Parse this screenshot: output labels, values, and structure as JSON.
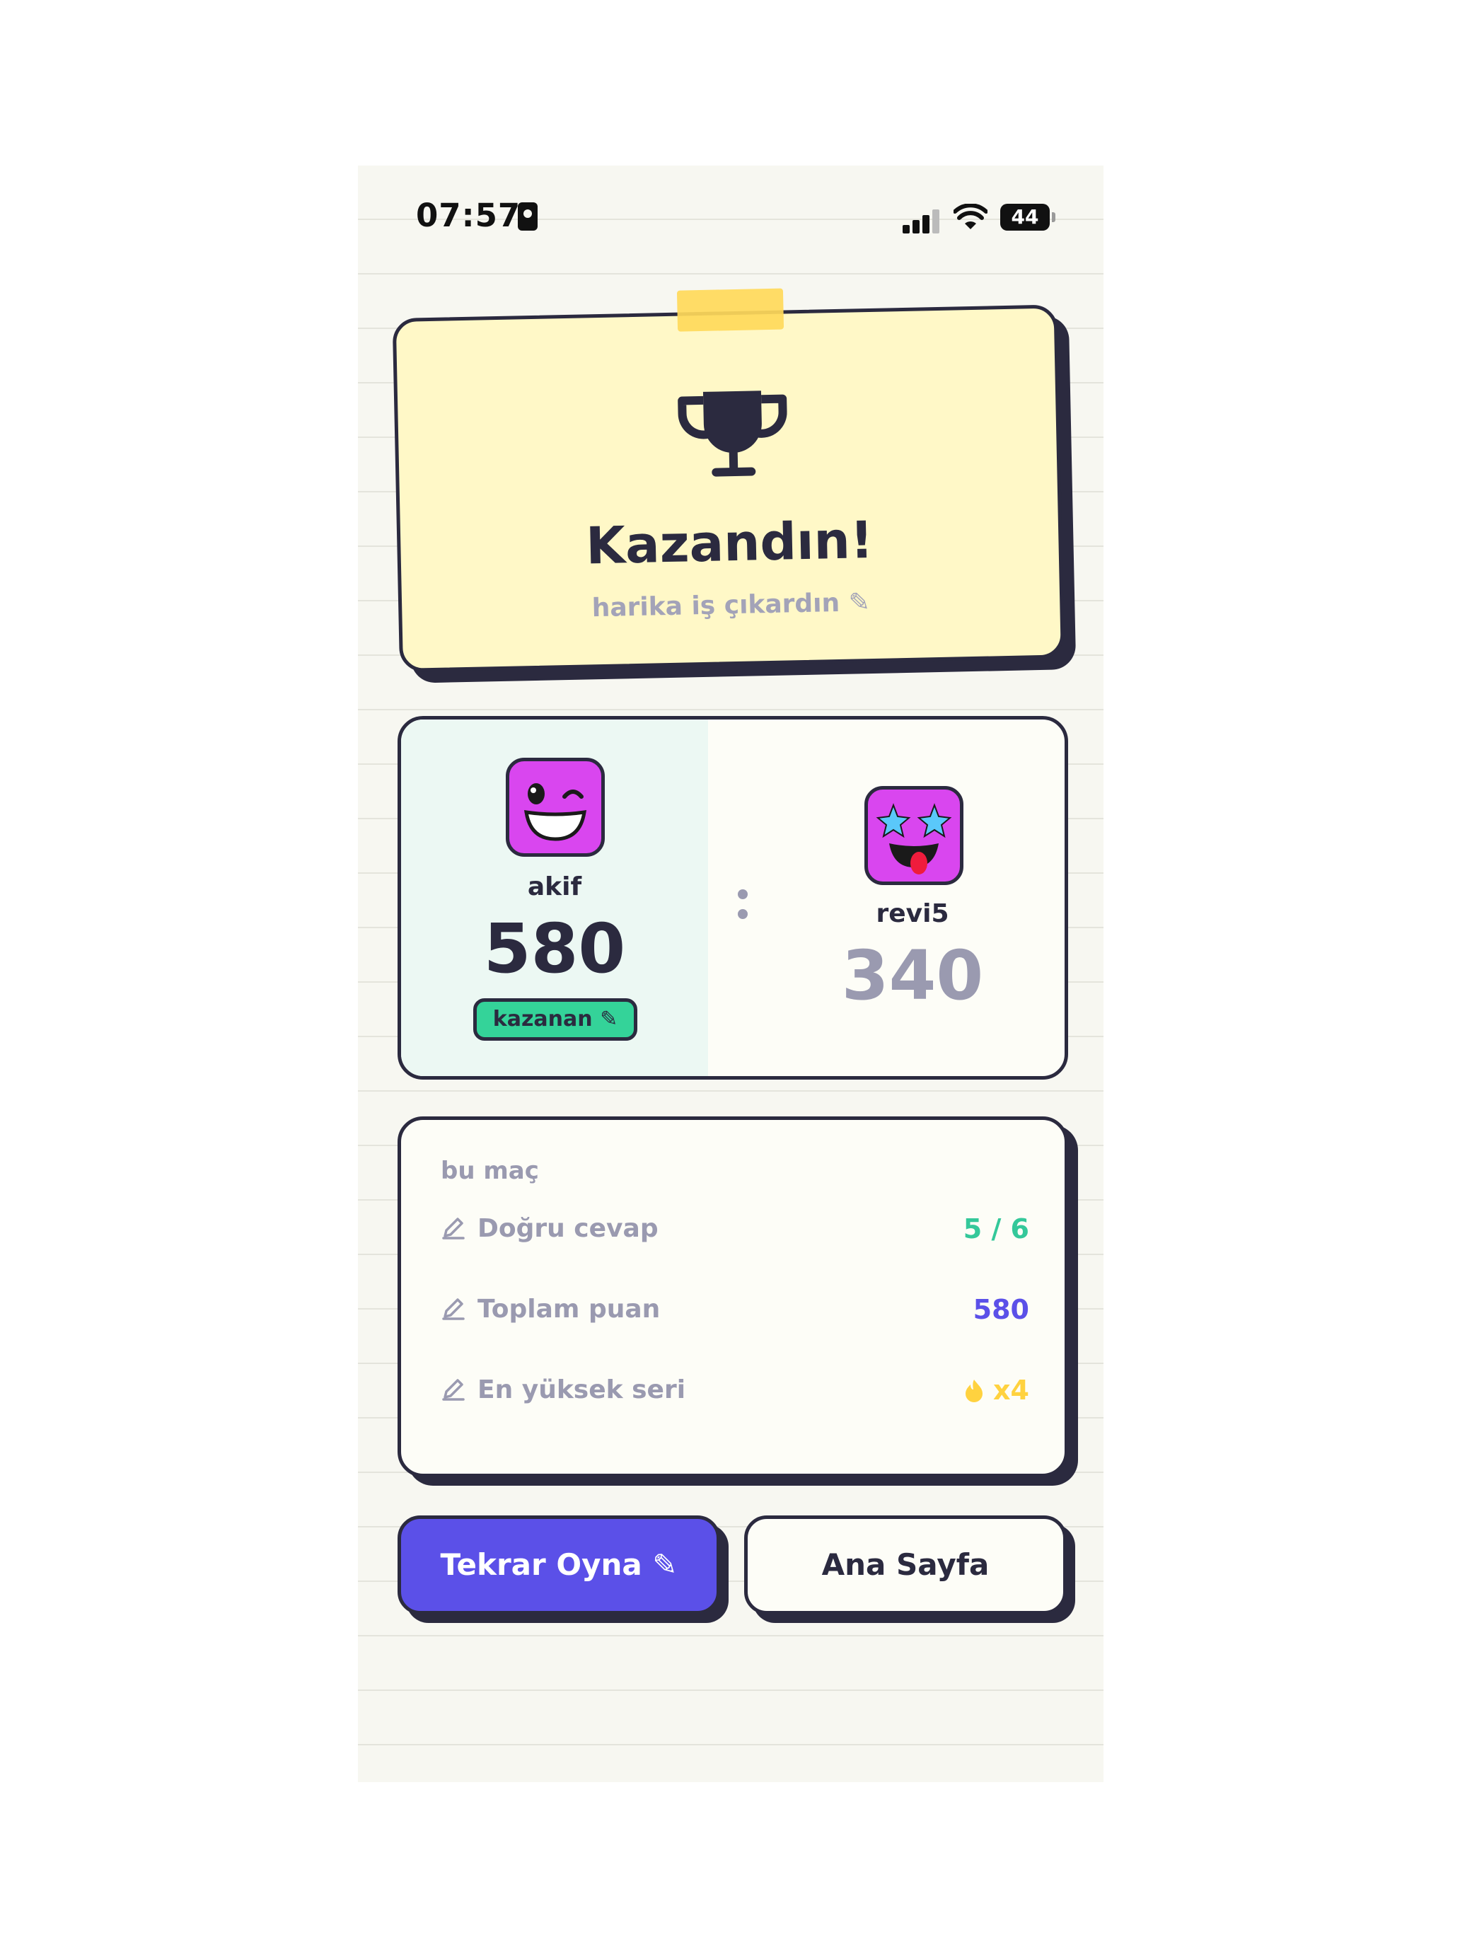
{
  "status_bar": {
    "time": "07:57",
    "battery": "44"
  },
  "result": {
    "title": "Kazandın!",
    "subtitle": "harika iş çıkardın ✎"
  },
  "players": [
    {
      "name": "akif",
      "score": "580",
      "badge": "kazanan ✎",
      "score_color": "#2b2a3f"
    },
    {
      "name": "revi5",
      "score": "340",
      "score_color": "#9a9ab0"
    }
  ],
  "stats": {
    "label": "bu maç",
    "rows": [
      {
        "label": "Doğru cevap",
        "value": "5 / 6",
        "color": "#34c89a"
      },
      {
        "label": "Toplam puan",
        "value": "580",
        "color": "#5b50e8"
      },
      {
        "label": "En yüksek seri",
        "value": "x4",
        "color": "#ffd23f",
        "icon": "fire-icon"
      }
    ]
  },
  "buttons": {
    "replay": "Tekrar Oyna ✎",
    "home": "Ana Sayfa"
  },
  "colors": {
    "accent": "#5b50e8",
    "success": "#34d399",
    "ink": "#2b2a3f",
    "paper": "#fff8c7",
    "avatar": "#d946ef"
  }
}
